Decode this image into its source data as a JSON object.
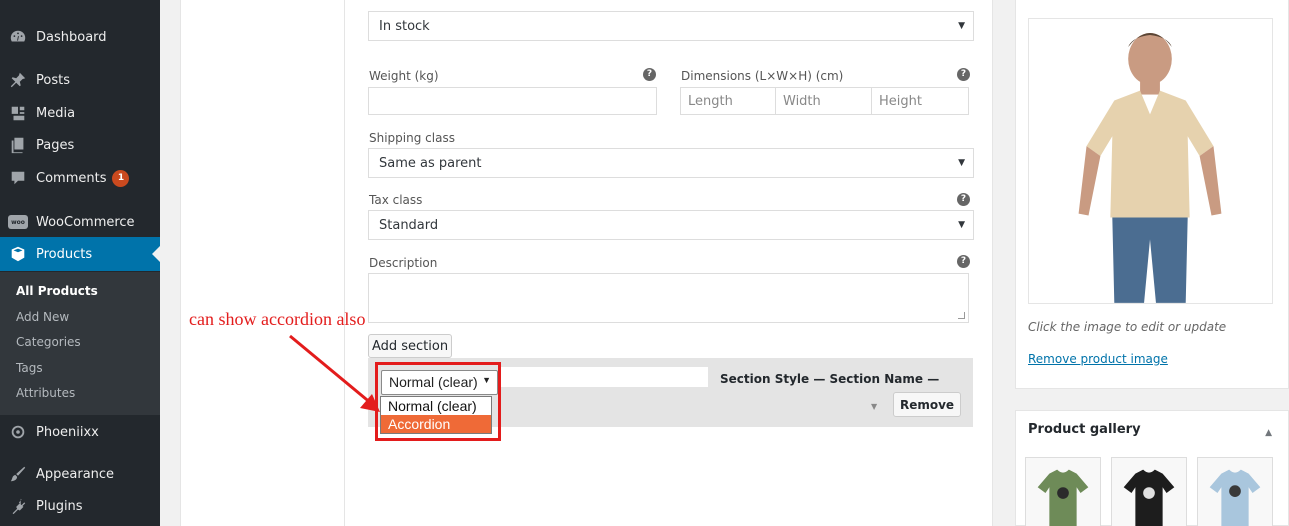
{
  "sidebar": {
    "items": [
      {
        "label": "Dashboard",
        "icon": "dashboard-icon"
      },
      {
        "label": "Posts",
        "icon": "pin-icon"
      },
      {
        "label": "Media",
        "icon": "media-icon"
      },
      {
        "label": "Pages",
        "icon": "pages-icon"
      },
      {
        "label": "Comments",
        "icon": "comments-icon",
        "badge": "1"
      },
      {
        "label": "WooCommerce",
        "icon": "woocommerce-icon",
        "logo_text": "woo"
      },
      {
        "label": "Products",
        "icon": "products-icon",
        "active": true
      },
      {
        "label": "Phoeniixx",
        "icon": "phoeniixx-icon"
      },
      {
        "label": "Appearance",
        "icon": "brush-icon"
      },
      {
        "label": "Plugins",
        "icon": "plugins-icon"
      }
    ],
    "submenu": [
      "All Products",
      "Add New",
      "Categories",
      "Tags",
      "Attributes"
    ]
  },
  "variation": {
    "stock_status": "In stock",
    "weight_label": "Weight (kg)",
    "dimensions_label": "Dimensions (L×W×H) (cm)",
    "length_placeholder": "Length",
    "width_placeholder": "Width",
    "height_placeholder": "Height",
    "shipping_label": "Shipping class",
    "shipping_value": "Same as parent",
    "tax_label": "Tax class",
    "tax_value": "Standard",
    "description_label": "Description",
    "help_glyph": "?"
  },
  "sections": {
    "add_button": "Add section",
    "style_label": "Section Style — Section Name —",
    "remove_button": "Remove",
    "style_select": {
      "selected": "Normal (clear)",
      "options": [
        "Normal (clear)",
        "Accordion"
      ],
      "highlighted": "Accordion"
    }
  },
  "annotation": {
    "text": "can show accordion also",
    "color": "#e31c1c"
  },
  "product_image": {
    "caption": "Click the image to edit or update",
    "remove_link": "Remove product image"
  },
  "gallery": {
    "title": "Product gallery",
    "thumbs": [
      {
        "name": "green-tshirt",
        "color": "#6e8b58"
      },
      {
        "name": "black-tshirt",
        "color": "#1d1d1d"
      },
      {
        "name": "blue-tshirt",
        "color": "#a9c6dd"
      }
    ]
  },
  "colors": {
    "sidebar_bg": "#23282d",
    "active_blue": "#0073aa",
    "highlight_orange": "#ef6a37"
  }
}
